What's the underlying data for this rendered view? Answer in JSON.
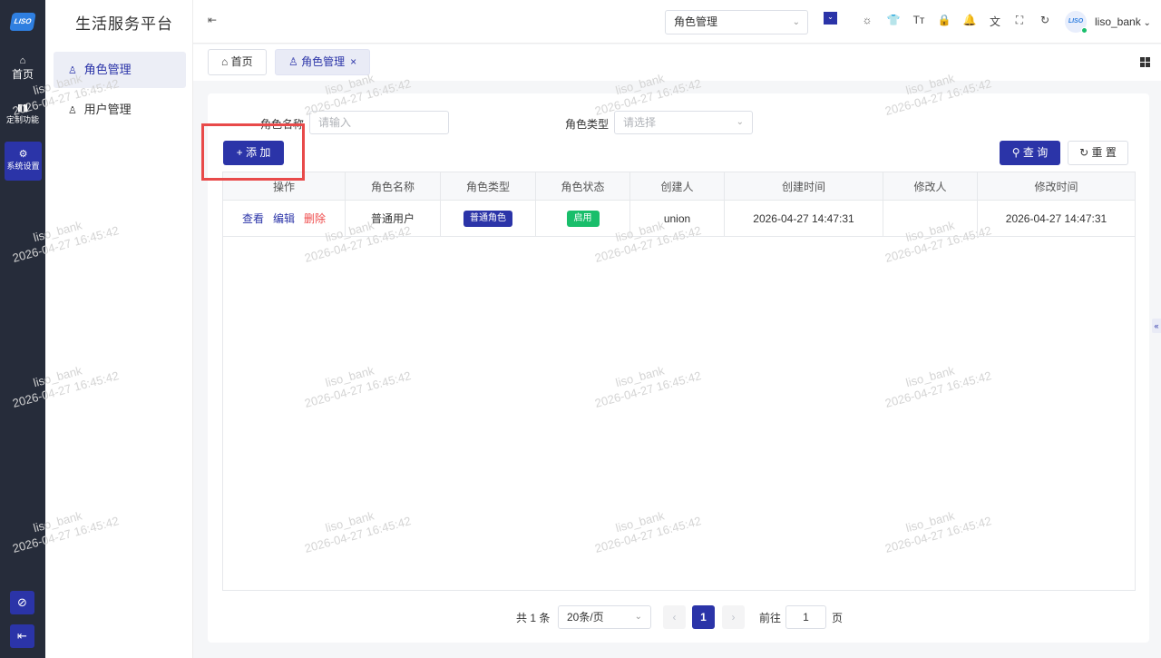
{
  "rail": {
    "logo": "LISO",
    "items": [
      {
        "label": "首页"
      },
      {
        "label": "定制功能"
      },
      {
        "label": "系统设置"
      }
    ]
  },
  "sidebar": {
    "title": "生活服务平台",
    "items": [
      {
        "label": "角色管理",
        "active": true
      },
      {
        "label": "用户管理",
        "active": false
      }
    ]
  },
  "header": {
    "search_value": "角色管理",
    "username": "liso_bank",
    "avatar_text": "LISO"
  },
  "tabs": [
    {
      "label": "首页"
    },
    {
      "label": "角色管理"
    }
  ],
  "filters": {
    "role_name_label": "角色名称",
    "role_name_placeholder": "请输入",
    "role_type_label": "角色类型",
    "role_type_placeholder": "请选择"
  },
  "buttons": {
    "add": "添 加",
    "query": "查 询",
    "reset": "重 置"
  },
  "table": {
    "columns": [
      "操作",
      "角色名称",
      "角色类型",
      "角色状态",
      "创建人",
      "创建时间",
      "修改人",
      "修改时间"
    ],
    "rows": [
      {
        "actions": [
          "查看",
          "编辑",
          "删除"
        ],
        "role_name": "普通用户",
        "role_type": "普通角色",
        "status": "启用",
        "creator": "union",
        "created_at": "2026-04-27 14:47:31",
        "modifier": "",
        "modified_at": "2026-04-27 14:47:31"
      }
    ]
  },
  "pagination": {
    "total": "共 1 条",
    "page_size": "20条/页",
    "current": "1",
    "goto_label": "前往",
    "goto_value": "1",
    "unit": "页"
  },
  "watermark": {
    "user": "liso_bank",
    "time": "2026-04-27 16:45:42"
  },
  "colors": {
    "primary": "#2b34a8",
    "danger": "#ef4a4a",
    "success": "#19be6b",
    "rail_bg": "#262c3a",
    "highlight": "#e84a4a"
  }
}
